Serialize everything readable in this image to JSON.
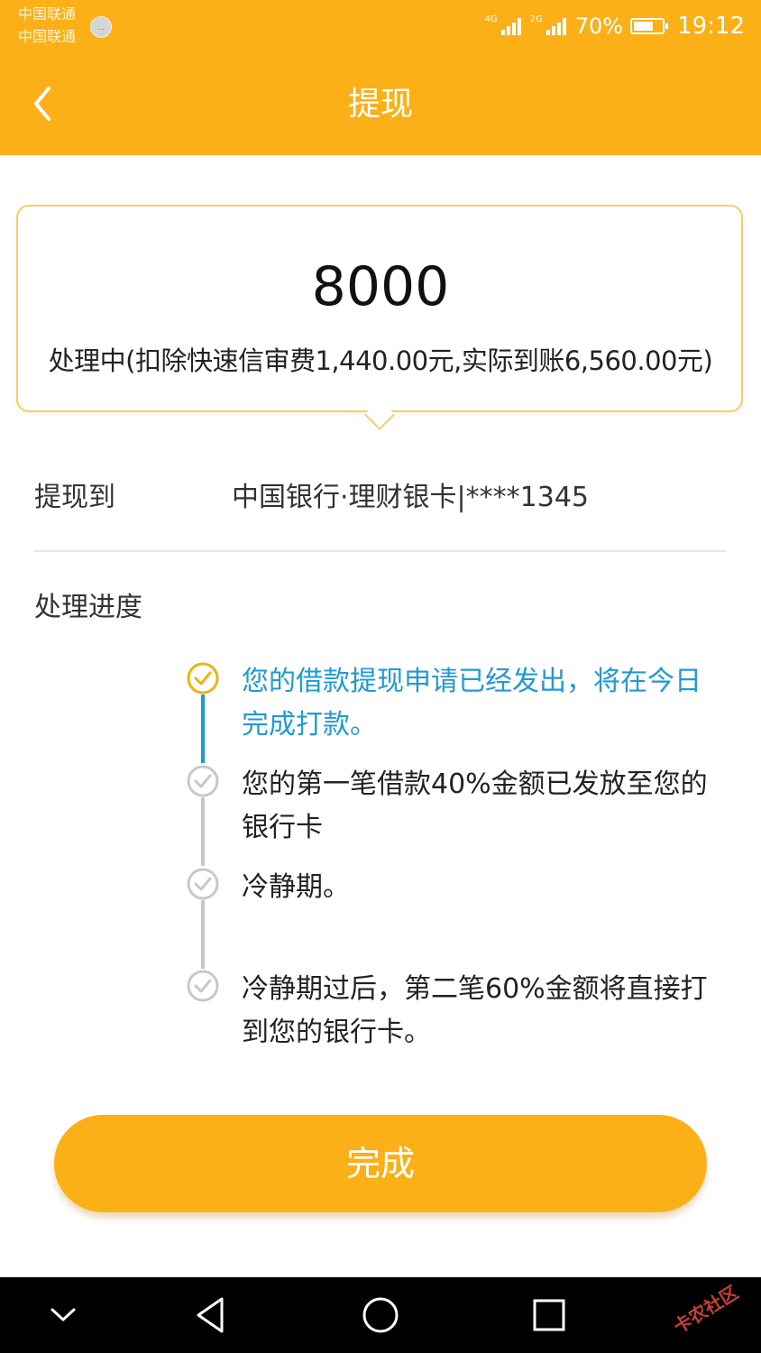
{
  "status_bar": {
    "carrier_1": "中国联通",
    "carrier_2": "中国联通",
    "carrier_badge": "…",
    "net_1": "4G",
    "net_2": "2G",
    "battery_percent": "70%",
    "battery_level": 0.7,
    "time": "19:12"
  },
  "nav": {
    "back_icon": "chevron-left-icon",
    "title": "提现"
  },
  "amount_card": {
    "amount": "8000",
    "status_text": "处理中(扣除快速信审费1,440.00元,实际到账6,560.00元)"
  },
  "destination": {
    "label": "提现到",
    "value": "中国银行·理财银卡|****1345"
  },
  "progress": {
    "label": "处理进度",
    "steps": [
      {
        "text": "您的借款提现申请已经发出，将在今日完成打款。",
        "state": "current"
      },
      {
        "text": "您的第一笔借款40%金额已发放至您的银行卡",
        "state": "pending"
      },
      {
        "text": "冷静期。",
        "state": "pending"
      },
      {
        "text": "冷静期过后，第二笔60%金额将直接打到您的银行卡。",
        "state": "pending"
      }
    ]
  },
  "done_button": {
    "label": "完成"
  },
  "system_nav": {
    "icons": [
      "chevron-down-icon",
      "back-triangle-icon",
      "home-circle-icon",
      "recents-square-icon"
    ]
  },
  "watermark": "卡农社区",
  "colors": {
    "brand": "#fbb018",
    "active_step": "#1e9bd7",
    "card_border": "#f2cf6a",
    "inactive_step": "#c8c8c8"
  }
}
